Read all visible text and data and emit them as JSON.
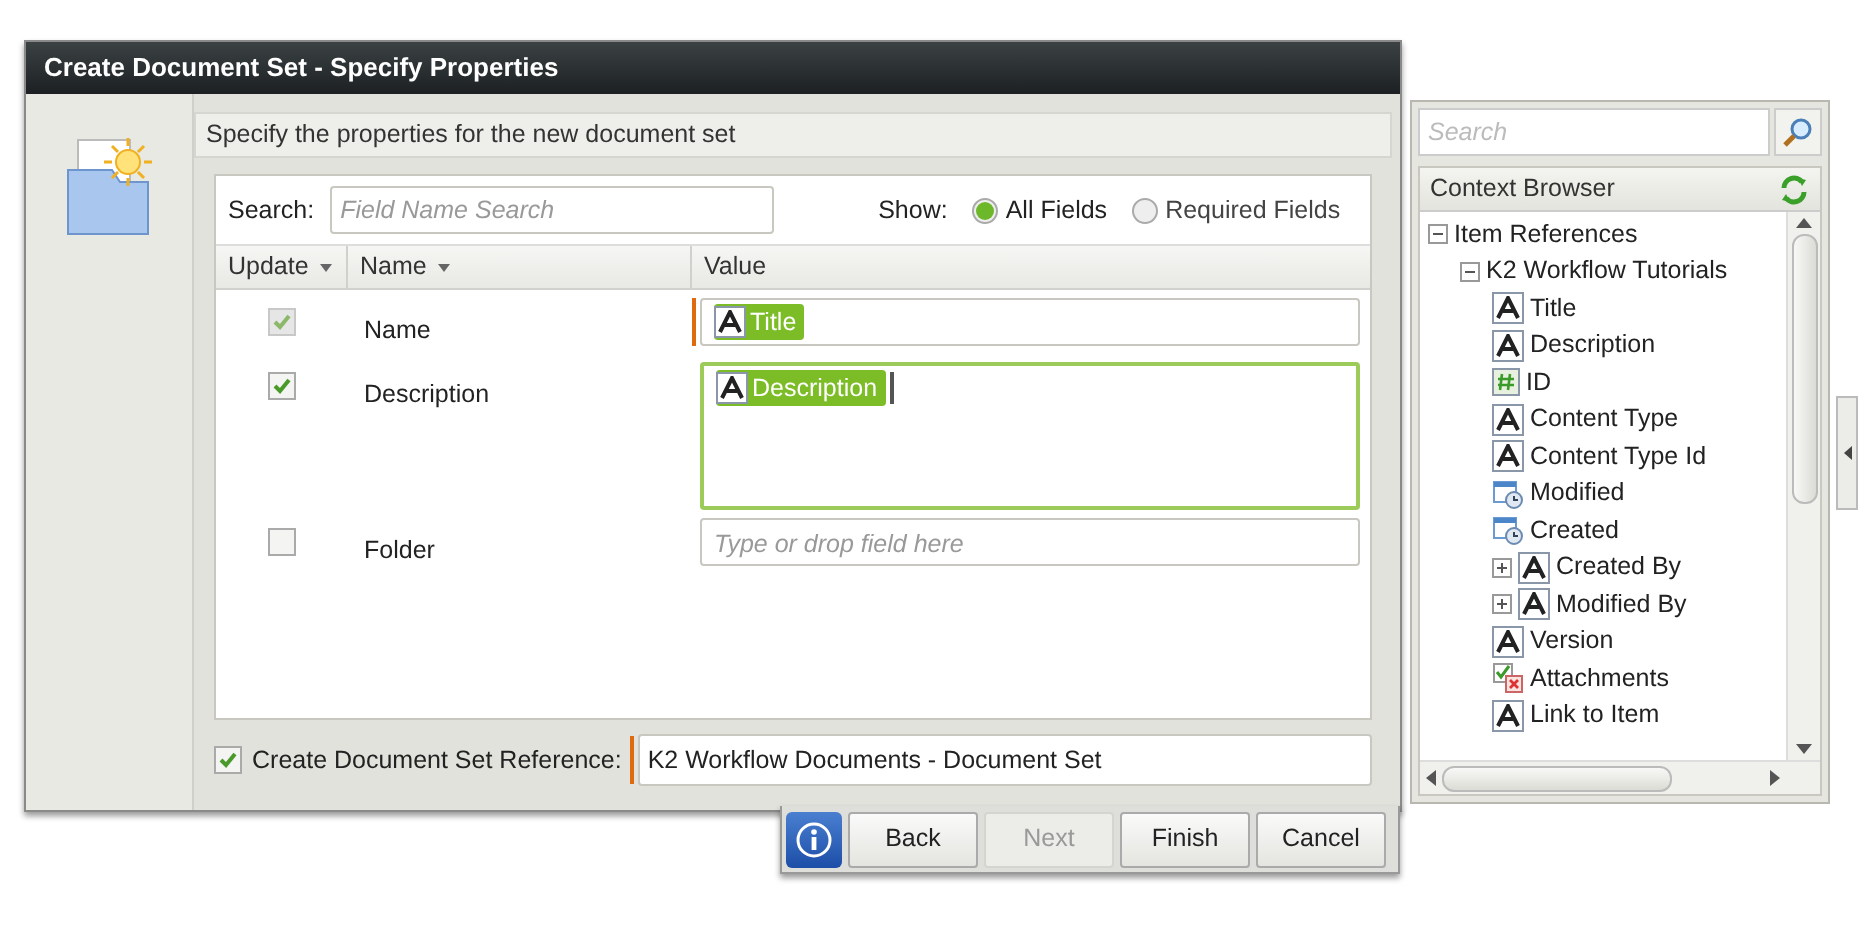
{
  "window": {
    "title": "Create Document Set - Specify Properties"
  },
  "instructions": "Specify the properties for the new document set",
  "search": {
    "label": "Search:",
    "placeholder": "Field Name Search"
  },
  "show": {
    "label": "Show:",
    "options": [
      {
        "label": "All Fields",
        "selected": true
      },
      {
        "label": "Required Fields",
        "selected": false
      }
    ]
  },
  "table": {
    "columns": [
      {
        "label": "Update",
        "sortable": true
      },
      {
        "label": "Name",
        "sortable": true
      },
      {
        "label": "Value",
        "sortable": false
      }
    ],
    "rows": [
      {
        "checked": true,
        "disabled": true,
        "name": "Name",
        "kind": "single",
        "required": true,
        "focused": false,
        "tokens": [
          {
            "label": "Title"
          }
        ]
      },
      {
        "checked": true,
        "disabled": false,
        "name": "Description",
        "kind": "multi",
        "required": false,
        "focused": true,
        "tokens": [
          {
            "label": "Description"
          }
        ]
      },
      {
        "checked": false,
        "disabled": false,
        "name": "Folder",
        "kind": "single",
        "required": false,
        "focused": false,
        "placeholder": "Type or drop field here",
        "tokens": []
      }
    ]
  },
  "reference": {
    "checked": true,
    "label": "Create Document Set Reference:",
    "value": "K2 Workflow Documents - Document Set"
  },
  "buttons": [
    {
      "label": "Back",
      "disabled": false
    },
    {
      "label": "Next",
      "disabled": true
    },
    {
      "label": "Finish",
      "disabled": false
    },
    {
      "label": "Cancel",
      "disabled": false
    }
  ],
  "context_browser": {
    "search_placeholder": "Search",
    "title": "Context Browser",
    "tree": [
      {
        "label": "Item References",
        "expanded": true,
        "children": [
          {
            "label": "K2 Workflow Tutorials",
            "expanded": true,
            "children": [
              {
                "label": "Title",
                "kind": "text"
              },
              {
                "label": "Description",
                "kind": "text"
              },
              {
                "label": "ID",
                "kind": "number"
              },
              {
                "label": "Content Type",
                "kind": "text"
              },
              {
                "label": "Content Type Id",
                "kind": "text"
              },
              {
                "label": "Modified",
                "kind": "date"
              },
              {
                "label": "Created",
                "kind": "date"
              },
              {
                "label": "Created By",
                "kind": "text",
                "expanded": false
              },
              {
                "label": "Modified By",
                "kind": "text",
                "expanded": false
              },
              {
                "label": "Version",
                "kind": "text"
              },
              {
                "label": "Attachments",
                "kind": "attachment"
              },
              {
                "label": "Link to Item",
                "kind": "text"
              }
            ]
          }
        ]
      }
    ]
  }
}
